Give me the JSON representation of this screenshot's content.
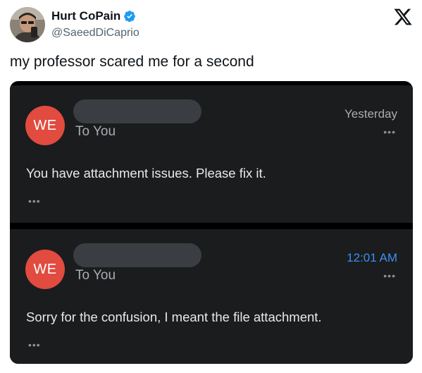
{
  "tweet": {
    "author_name": "Hurt CoPain",
    "author_handle": "@SaeedDiCaprio",
    "text": "my professor scared me for a second",
    "platform_icon": "x-logo-icon",
    "verified_icon": "verified-badge-icon",
    "colors": {
      "verified": "#1d9bf0",
      "name": "#0f1419",
      "handle": "#536471"
    }
  },
  "email_screenshot": {
    "emails": [
      {
        "avatar_initials": "WE",
        "recipient": "To You",
        "time": "Yesterday",
        "more_label": "•••",
        "message": "You have attachment issues. Please fix it.",
        "message_more_label": "•••"
      },
      {
        "avatar_initials": "WE",
        "recipient": "To You",
        "time": "12:01 AM",
        "more_label": "•••",
        "message": "Sorry for the confusion, I meant the file attachment.",
        "message_more_label": "•••"
      }
    ],
    "colors": {
      "card_background": "#1b1c1e",
      "avatar": "#e14b40",
      "time_highlight": "#3b8ff0",
      "redaction": "#3a3d42"
    }
  }
}
